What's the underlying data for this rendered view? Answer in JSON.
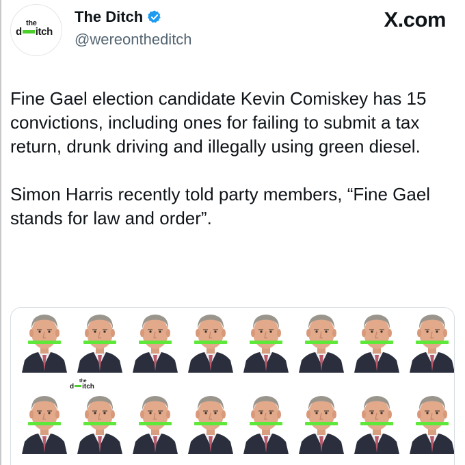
{
  "account": {
    "display_name": "The Ditch",
    "handle": "@wereontheditch",
    "verified": true,
    "avatar_logo": {
      "top": "the",
      "left": "d",
      "right": "itch"
    }
  },
  "source_label": "X.com",
  "tweet": {
    "paragraph_1": "Fine Gael election candidate Kevin Comiskey has 15 convictions, including ones for failing to submit a tax return, drunk driving and illegally using green diesel.",
    "paragraph_2": "Simon Harris recently told party members, “Fine Gael stands for law and order”."
  },
  "media": {
    "watermark": {
      "top": "the",
      "left": "d",
      "right": "itch"
    },
    "portrait_count": 16,
    "censor_bar_color": "#5ee83a"
  },
  "colors": {
    "verified": "#1d9bf0",
    "brand_green": "#4ccf2c",
    "handle_gray": "#536471"
  },
  "icons": {
    "verified": "verified-badge-icon"
  }
}
